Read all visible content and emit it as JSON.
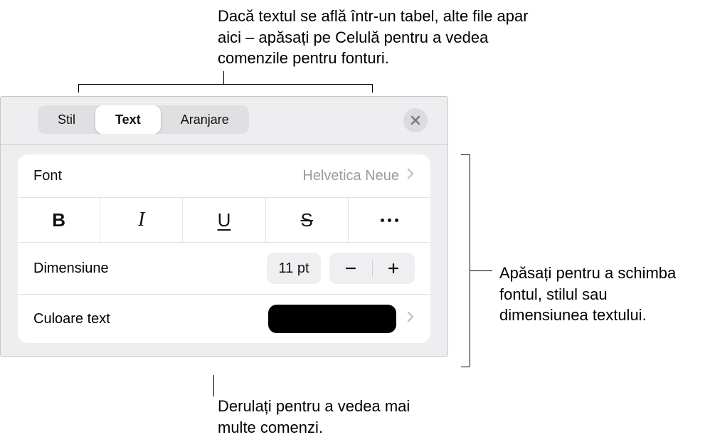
{
  "callouts": {
    "top": "Dacă textul se află într-un tabel, alte file apar aici – apăsați pe Celulă pentru a vedea comenzile pentru fonturi.",
    "right": "Apăsați pentru a schimba fontul, stilul sau dimensiunea textului.",
    "bottom": "Derulați pentru a vedea mai multe comenzi."
  },
  "tabs": {
    "stil": "Stil",
    "text": "Text",
    "arrange": "Aranjare"
  },
  "rows": {
    "font_label": "Font",
    "font_value": "Helvetica Neue",
    "bold_glyph": "B",
    "italic_glyph": "I",
    "underline_glyph": "U",
    "strike_glyph": "S",
    "size_label": "Dimensiune",
    "size_value": "11 pt",
    "color_label": "Culoare text"
  },
  "colors": {
    "swatch": "#000000"
  }
}
